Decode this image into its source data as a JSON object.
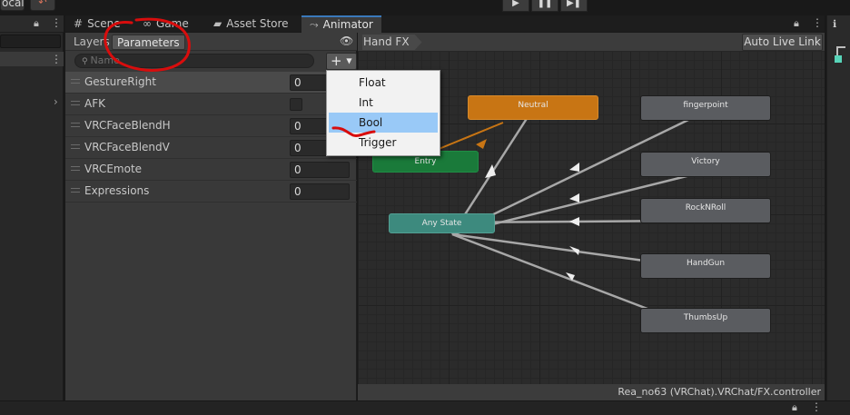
{
  "toolbar": {
    "local_label": "ocal",
    "undo_icon": "collab-history-icon",
    "play_buttons": [
      {
        "name": "play-button",
        "glyph": "▶"
      },
      {
        "name": "pause-button",
        "glyph": "❚❚"
      },
      {
        "name": "step-button",
        "glyph": "▶❚"
      }
    ]
  },
  "tabs": [
    {
      "label": "Scene",
      "glyph": "#"
    },
    {
      "label": "Game",
      "glyph": "∞"
    },
    {
      "label": "Asset Store",
      "glyph": "▰"
    },
    {
      "label": "Animator",
      "glyph": "⤳"
    }
  ],
  "params_panel": {
    "layers_label": "Layers",
    "parameters_label": "Parameters",
    "search_placeholder": "Name",
    "add_label": "+",
    "parameters": [
      {
        "name": "GestureRight",
        "type": "int",
        "value": "0",
        "selected": true
      },
      {
        "name": "AFK",
        "type": "bool",
        "value": ""
      },
      {
        "name": "VRCFaceBlendH",
        "type": "float",
        "value": "0"
      },
      {
        "name": "VRCFaceBlendV",
        "type": "float",
        "value": "0"
      },
      {
        "name": "VRCEmote",
        "type": "int",
        "value": "0"
      },
      {
        "name": "Expressions",
        "type": "int",
        "value": "0"
      }
    ]
  },
  "popup": {
    "items": [
      "Float",
      "Int",
      "Bool",
      "Trigger"
    ],
    "highlighted": "Bool"
  },
  "graph": {
    "layer_name": "Hand FX",
    "live_link_label": "Auto Live Link",
    "status_path": "Rea_no63 (VRChat).VRChat/FX.controller",
    "states": [
      "Neutral",
      "Entry",
      "Any State",
      "fingerpoint",
      "Victory",
      "RockNRoll",
      "HandGun",
      "ThumbsUp"
    ]
  },
  "colors": {
    "accent_tab": "#3a79bb",
    "state_default": "#c87514",
    "entry": "#1a7a3a",
    "any_state": "#3d8a7e",
    "state": "#5a5c60",
    "annotation": "#d80d0d",
    "popup_highlight": "#99c9f7"
  }
}
